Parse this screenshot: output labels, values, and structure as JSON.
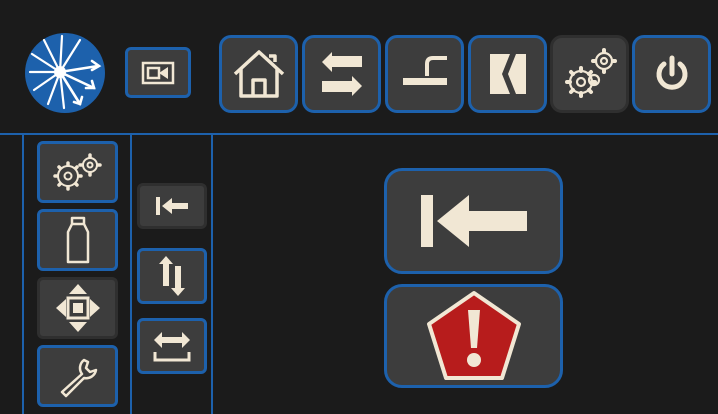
{
  "colors": {
    "background": "#1b1b1b",
    "button_fill": "#3d3d3d",
    "button_border": "#1d61ac",
    "icon_cream": "#f1e7d4",
    "warning_red": "#b71c1c",
    "logo_blue": "#1d61ac"
  },
  "top_bar": {
    "logo": "starburst-logo",
    "buttons": [
      "camera-icon",
      "home-icon",
      "swap-icon",
      "bench-icon",
      "alignment-icon",
      "gears-icon",
      "power-icon"
    ],
    "selected": "gears-icon"
  },
  "side_bar": {
    "buttons": [
      "gears-icon",
      "weight-icon",
      "move-arrows-icon",
      "wrench-icon"
    ],
    "selected": "move-arrows-icon"
  },
  "sub_bar": {
    "buttons": [
      "move-left-icon",
      "vertical-arrows-icon",
      "horizontal-span-icon"
    ],
    "selected": "move-left-icon"
  },
  "main": {
    "buttons": [
      "move-left-icon",
      "warning-icon"
    ]
  }
}
